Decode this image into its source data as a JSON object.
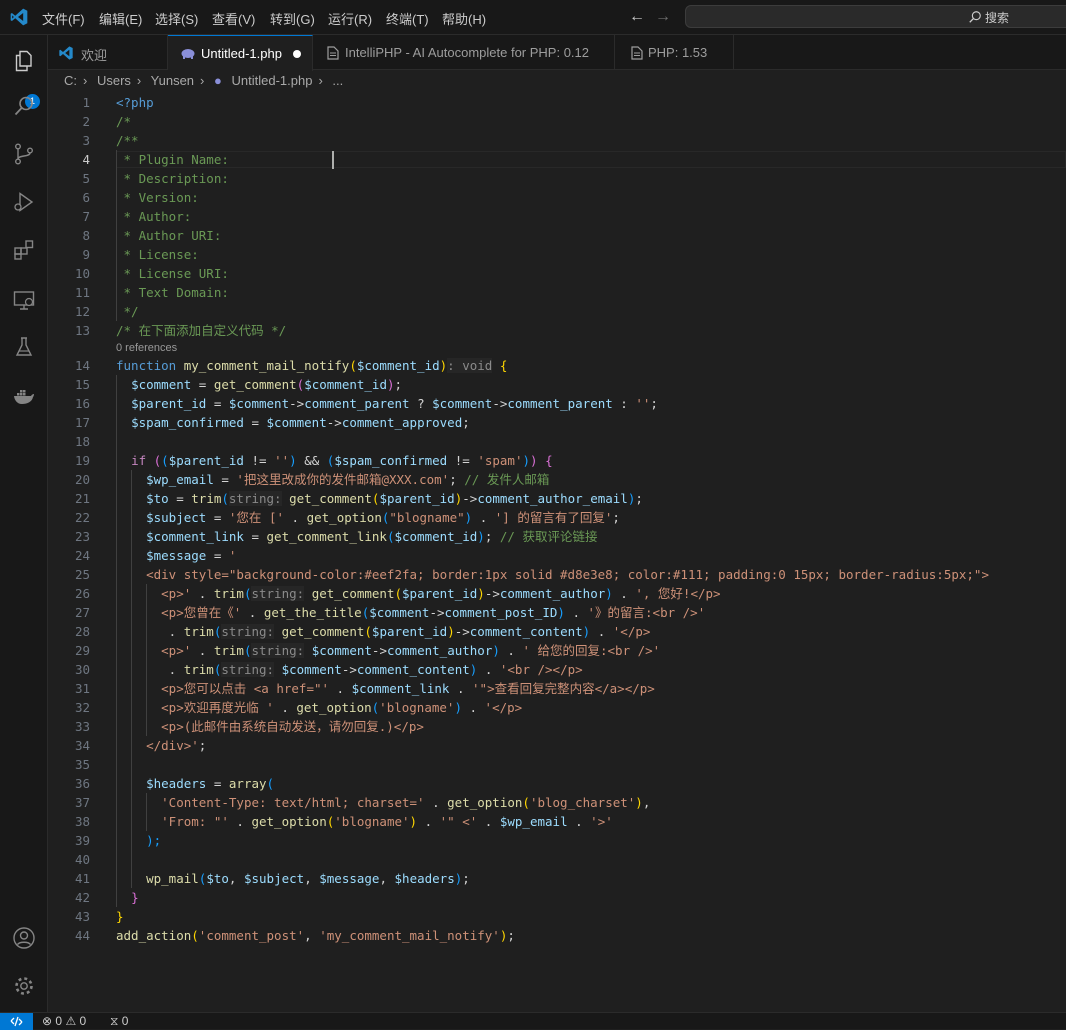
{
  "menu": [
    "文件(F)",
    "编辑(E)",
    "选择(S)",
    "查看(V)",
    "转到(G)",
    "运行(R)",
    "终端(T)",
    "帮助(H)"
  ],
  "search": {
    "label": "搜索"
  },
  "activity": {
    "explorer_badge": "1"
  },
  "tabs": [
    {
      "label": "欢迎",
      "icon": "vscode-icon"
    },
    {
      "label": "Untitled-1.php",
      "icon": "php-icon",
      "active": true,
      "modified": true
    },
    {
      "label": "IntelliPHP - AI Autocomplete for PHP: 0.12",
      "icon": "extension-icon"
    },
    {
      "label": "PHP: 1.53",
      "icon": "extension-icon"
    }
  ],
  "breadcrumb": [
    "C:",
    "Users",
    "Yunsen",
    "Untitled-1.php",
    "..."
  ],
  "codelens": {
    "text": "0 references",
    "before_line": 14
  },
  "line_count": 44,
  "current_line": 4,
  "colors": {
    "accent": "#0078d4",
    "editor_bg": "#1f1f1f",
    "chrome_bg": "#181818"
  },
  "status": {
    "errors": "0",
    "warnings": "0",
    "ports": "0"
  },
  "code_lines": [
    [
      [
        "<?php",
        "tag"
      ]
    ],
    [
      [
        "/*",
        "cm"
      ]
    ],
    [
      [
        "/**",
        "cm"
      ]
    ],
    [
      [
        " * Plugin Name:",
        "cm"
      ]
    ],
    [
      [
        " * Description:",
        "cm"
      ]
    ],
    [
      [
        " * Version:",
        "cm"
      ]
    ],
    [
      [
        " * Author:",
        "cm"
      ]
    ],
    [
      [
        " * Author URI:",
        "cm"
      ]
    ],
    [
      [
        " * License:",
        "cm"
      ]
    ],
    [
      [
        " * License URI:",
        "cm"
      ]
    ],
    [
      [
        " * Text Domain:",
        "cm"
      ]
    ],
    [
      [
        " */",
        "cm"
      ]
    ],
    [
      [
        "/* 在下面添加自定义代码 */",
        "cm"
      ]
    ],
    [
      [
        "function ",
        "kw"
      ],
      [
        "my_comment_mail_notify",
        "fn"
      ],
      [
        "(",
        "b1"
      ],
      [
        "$comment_id",
        "var"
      ],
      [
        ")",
        "b1"
      ],
      [
        ": void",
        "hint"
      ],
      [
        " ",
        ""
      ],
      [
        "{",
        "b1"
      ]
    ],
    [
      [
        "  ",
        ""
      ],
      [
        "$comment",
        "var"
      ],
      [
        " = ",
        "op"
      ],
      [
        "get_comment",
        "fn"
      ],
      [
        "(",
        "b2"
      ],
      [
        "$comment_id",
        "var"
      ],
      [
        ")",
        "b2"
      ],
      [
        ";",
        "op"
      ]
    ],
    [
      [
        "  ",
        ""
      ],
      [
        "$parent_id",
        "var"
      ],
      [
        " = ",
        "op"
      ],
      [
        "$comment",
        "var"
      ],
      [
        "->",
        "op"
      ],
      [
        "comment_parent",
        "var"
      ],
      [
        " ? ",
        "op"
      ],
      [
        "$comment",
        "var"
      ],
      [
        "->",
        "op"
      ],
      [
        "comment_parent",
        "var"
      ],
      [
        " : ",
        "op"
      ],
      [
        "''",
        "str"
      ],
      [
        ";",
        "op"
      ]
    ],
    [
      [
        "  ",
        ""
      ],
      [
        "$spam_confirmed",
        "var"
      ],
      [
        " = ",
        "op"
      ],
      [
        "$comment",
        "var"
      ],
      [
        "->",
        "op"
      ],
      [
        "comment_approved",
        "var"
      ],
      [
        ";",
        "op"
      ]
    ],
    [],
    [
      [
        "  ",
        ""
      ],
      [
        "if ",
        "ctl"
      ],
      [
        "(",
        "b2"
      ],
      [
        "(",
        "b3"
      ],
      [
        "$parent_id",
        "var"
      ],
      [
        " != ",
        "op"
      ],
      [
        "''",
        "str"
      ],
      [
        ")",
        "b3"
      ],
      [
        " && ",
        "op"
      ],
      [
        "(",
        "b3"
      ],
      [
        "$spam_confirmed",
        "var"
      ],
      [
        " != ",
        "op"
      ],
      [
        "'spam'",
        "str"
      ],
      [
        ")",
        "b3"
      ],
      [
        ")",
        "b2"
      ],
      [
        " ",
        ""
      ],
      [
        "{",
        "b2"
      ]
    ],
    [
      [
        "    ",
        ""
      ],
      [
        "$wp_email",
        "var"
      ],
      [
        " = ",
        "op"
      ],
      [
        "'把这里改成你的发件邮箱@XXX.com'",
        "str"
      ],
      [
        ";",
        "op"
      ],
      [
        " // 发件人邮箱",
        "cm"
      ]
    ],
    [
      [
        "    ",
        ""
      ],
      [
        "$to",
        "var"
      ],
      [
        " = ",
        "op"
      ],
      [
        "trim",
        "fn"
      ],
      [
        "(",
        "b3"
      ],
      [
        "string:",
        "hint"
      ],
      [
        " ",
        ""
      ],
      [
        "get_comment",
        "fn"
      ],
      [
        "(",
        "b1"
      ],
      [
        "$parent_id",
        "var"
      ],
      [
        ")",
        "b1"
      ],
      [
        "->",
        "op"
      ],
      [
        "comment_author_email",
        "var"
      ],
      [
        ")",
        "b3"
      ],
      [
        ";",
        "op"
      ]
    ],
    [
      [
        "    ",
        ""
      ],
      [
        "$subject",
        "var"
      ],
      [
        " = ",
        "op"
      ],
      [
        "'您在 ['",
        "str"
      ],
      [
        " . ",
        "op"
      ],
      [
        "get_option",
        "fn"
      ],
      [
        "(",
        "b3"
      ],
      [
        "\"blogname\"",
        "str"
      ],
      [
        ")",
        "b3"
      ],
      [
        " . ",
        "op"
      ],
      [
        "'] 的留言有了回复'",
        "str"
      ],
      [
        ";",
        "op"
      ]
    ],
    [
      [
        "    ",
        ""
      ],
      [
        "$comment_link",
        "var"
      ],
      [
        " = ",
        "op"
      ],
      [
        "get_comment_link",
        "fn"
      ],
      [
        "(",
        "b3"
      ],
      [
        "$comment_id",
        "var"
      ],
      [
        ")",
        "b3"
      ],
      [
        ";",
        "op"
      ],
      [
        " // 获取评论链接",
        "cm"
      ]
    ],
    [
      [
        "    ",
        ""
      ],
      [
        "$message",
        "var"
      ],
      [
        " = ",
        "op"
      ],
      [
        "'",
        "str"
      ]
    ],
    [
      [
        "    ",
        ""
      ],
      [
        "<div style=\"background-color:#eef2fa; border:1px solid #d8e3e8; color:#111; padding:0 15px; border-radius:5px;\">",
        "str"
      ]
    ],
    [
      [
        "      ",
        ""
      ],
      [
        "<p>'",
        "str"
      ],
      [
        " . ",
        "op"
      ],
      [
        "trim",
        "fn"
      ],
      [
        "(",
        "b3"
      ],
      [
        "string:",
        "hint"
      ],
      [
        " ",
        ""
      ],
      [
        "get_comment",
        "fn"
      ],
      [
        "(",
        "b1"
      ],
      [
        "$parent_id",
        "var"
      ],
      [
        ")",
        "b1"
      ],
      [
        "->",
        "op"
      ],
      [
        "comment_author",
        "var"
      ],
      [
        ")",
        "b3"
      ],
      [
        " . ",
        "op"
      ],
      [
        "', 您好!</p>",
        "str"
      ]
    ],
    [
      [
        "      ",
        ""
      ],
      [
        "<p>您曾在《'",
        "str"
      ],
      [
        " . ",
        "op"
      ],
      [
        "get_the_title",
        "fn"
      ],
      [
        "(",
        "b3"
      ],
      [
        "$comment",
        "var"
      ],
      [
        "->",
        "op"
      ],
      [
        "comment_post_ID",
        "var"
      ],
      [
        ")",
        "b3"
      ],
      [
        " . ",
        "op"
      ],
      [
        "'》的留言:<br />'",
        "str"
      ]
    ],
    [
      [
        "       . ",
        ""
      ],
      [
        "trim",
        "fn"
      ],
      [
        "(",
        "b3"
      ],
      [
        "string:",
        "hint"
      ],
      [
        " ",
        ""
      ],
      [
        "get_comment",
        "fn"
      ],
      [
        "(",
        "b1"
      ],
      [
        "$parent_id",
        "var"
      ],
      [
        ")",
        "b1"
      ],
      [
        "->",
        "op"
      ],
      [
        "comment_content",
        "var"
      ],
      [
        ")",
        "b3"
      ],
      [
        " . ",
        "op"
      ],
      [
        "'</p>",
        "str"
      ]
    ],
    [
      [
        "      ",
        ""
      ],
      [
        "<p>'",
        "str"
      ],
      [
        " . ",
        "op"
      ],
      [
        "trim",
        "fn"
      ],
      [
        "(",
        "b3"
      ],
      [
        "string:",
        "hint"
      ],
      [
        " ",
        ""
      ],
      [
        "$comment",
        "var"
      ],
      [
        "->",
        "op"
      ],
      [
        "comment_author",
        "var"
      ],
      [
        ")",
        "b3"
      ],
      [
        " . ",
        "op"
      ],
      [
        "' 给您的回复:<br />'",
        "str"
      ]
    ],
    [
      [
        "       . ",
        ""
      ],
      [
        "trim",
        "fn"
      ],
      [
        "(",
        "b3"
      ],
      [
        "string:",
        "hint"
      ],
      [
        " ",
        ""
      ],
      [
        "$comment",
        "var"
      ],
      [
        "->",
        "op"
      ],
      [
        "comment_content",
        "var"
      ],
      [
        ")",
        "b3"
      ],
      [
        " . ",
        "op"
      ],
      [
        "'<br /></p>",
        "str"
      ]
    ],
    [
      [
        "      ",
        ""
      ],
      [
        "<p>您可以点击 <a href=\"'",
        "str"
      ],
      [
        " . ",
        "op"
      ],
      [
        "$comment_link",
        "var"
      ],
      [
        " . ",
        "op"
      ],
      [
        "'\">查看回复完整内容</a></p>",
        "str"
      ]
    ],
    [
      [
        "      ",
        ""
      ],
      [
        "<p>欢迎再度光临 '",
        "str"
      ],
      [
        " . ",
        "op"
      ],
      [
        "get_option",
        "fn"
      ],
      [
        "(",
        "b3"
      ],
      [
        "'blogname'",
        "str"
      ],
      [
        ")",
        "b3"
      ],
      [
        " . ",
        "op"
      ],
      [
        "'</p>",
        "str"
      ]
    ],
    [
      [
        "      ",
        ""
      ],
      [
        "<p>(此邮件由系统自动发送，请勿回复.)</p>",
        "str"
      ]
    ],
    [
      [
        "    ",
        ""
      ],
      [
        "</div>'",
        "str"
      ],
      [
        ";",
        "op"
      ]
    ],
    [],
    [
      [
        "    ",
        ""
      ],
      [
        "$headers",
        "var"
      ],
      [
        " = ",
        "op"
      ],
      [
        "array",
        "fn"
      ],
      [
        "(",
        "b3"
      ]
    ],
    [
      [
        "      ",
        ""
      ],
      [
        "'Content-Type: text/html; charset='",
        "str"
      ],
      [
        " . ",
        "op"
      ],
      [
        "get_option",
        "fn"
      ],
      [
        "(",
        "b1"
      ],
      [
        "'blog_charset'",
        "str"
      ],
      [
        ")",
        "b1"
      ],
      [
        ",",
        "op"
      ]
    ],
    [
      [
        "      ",
        ""
      ],
      [
        "'From: \"'",
        "str"
      ],
      [
        " . ",
        "op"
      ],
      [
        "get_option",
        "fn"
      ],
      [
        "(",
        "b1"
      ],
      [
        "'blogname'",
        "str"
      ],
      [
        ")",
        "b1"
      ],
      [
        " . ",
        "op"
      ],
      [
        "'\" <'",
        "str"
      ],
      [
        " . ",
        "op"
      ],
      [
        "$wp_email",
        "var"
      ],
      [
        " . ",
        "op"
      ],
      [
        "'>'",
        "str"
      ]
    ],
    [
      [
        "    ",
        ""
      ],
      [
        ");",
        "b3"
      ]
    ],
    [],
    [
      [
        "    ",
        ""
      ],
      [
        "wp_mail",
        "fn"
      ],
      [
        "(",
        "b3"
      ],
      [
        "$to",
        "var"
      ],
      [
        ", ",
        "op"
      ],
      [
        "$subject",
        "var"
      ],
      [
        ", ",
        "op"
      ],
      [
        "$message",
        "var"
      ],
      [
        ", ",
        "op"
      ],
      [
        "$headers",
        "var"
      ],
      [
        ")",
        "b3"
      ],
      [
        ";",
        "op"
      ]
    ],
    [
      [
        "  ",
        ""
      ],
      [
        "}",
        "b2"
      ]
    ],
    [
      [
        "}",
        "b1"
      ]
    ],
    [
      [
        "add_action",
        "fn"
      ],
      [
        "(",
        "b1"
      ],
      [
        "'comment_post'",
        "str"
      ],
      [
        ", ",
        "op"
      ],
      [
        "'my_comment_mail_notify'",
        "str"
      ],
      [
        ")",
        "b1"
      ],
      [
        ";",
        "op"
      ]
    ]
  ]
}
